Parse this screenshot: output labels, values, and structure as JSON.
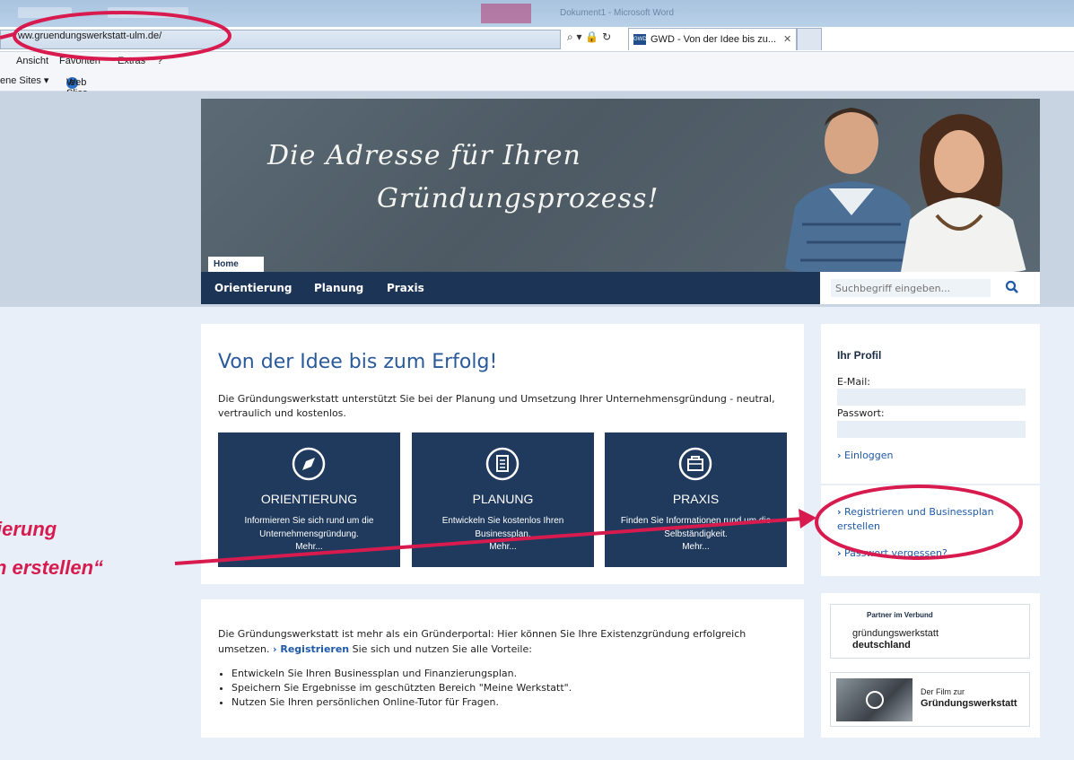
{
  "browser": {
    "url": "ww.gruendungswerkstatt-ulm.de/",
    "address_icons": "⌕ ▾ 🔒 ↻",
    "tab_favicon": "GWD",
    "tab_title": "GWD - Von der Idee bis zu...",
    "tab_close": "✕",
    "background_window_title": "Dokument1 - Microsoft Word",
    "menu": [
      "Ansicht",
      "Favoriten",
      "Extras",
      "?"
    ],
    "favorites": {
      "item1": "ene Sites ▾",
      "item2": "Web Slice-Katalog ▾"
    }
  },
  "hero": {
    "line1": "Die Adresse für Ihren",
    "line2": "Gründungsprozess!",
    "home_tab": "Home"
  },
  "nav": {
    "items": [
      "Orientierung",
      "Planung",
      "Praxis"
    ],
    "search_placeholder": "Suchbegriff eingeben..."
  },
  "main": {
    "title": "Von der Idee bis zum Erfolg!",
    "intro": "Die Gründungswerkstatt unterstützt Sie bei der Planung und Umsetzung Ihrer Unternehmensgründung - neutral, vertraulich und kostenlos.",
    "tiles": [
      {
        "title": "ORIENTIERUNG",
        "desc": "Informieren Sie sich rund um die Unternehmensgründung.",
        "more": "Mehr..."
      },
      {
        "title": "PLANUNG",
        "desc": "Entwickeln Sie kostenlos Ihren Businessplan.",
        "more": "Mehr..."
      },
      {
        "title": "PRAXIS",
        "desc": "Finden Sie Informationen rund um die Selbständigkeit.",
        "more": "Mehr..."
      }
    ]
  },
  "info": {
    "text_before": "Die Gründungswerkstatt ist mehr als ein Gründerportal: Hier können Sie Ihre Existenzgründung erfolgreich umsetzen. ",
    "register_link": "› Registrieren",
    "text_after": " Sie sich und nutzen Sie alle Vorteile:",
    "bullets": [
      "Entwickeln Sie Ihren Businessplan und Finanzierungsplan.",
      "Speichern Sie Ergebnisse im geschützten Bereich \"Meine Werkstatt\".",
      "Nutzen Sie Ihren persönlichen Online-Tutor für Fragen."
    ]
  },
  "profile": {
    "title": "Ihr Profil",
    "email_label": "E-Mail:",
    "password_label": "Passwort:",
    "login_link": "Einloggen",
    "register_link_line1": "Registrieren und Businessplan",
    "register_link_line2": "erstellen",
    "forgot_link": "Passwort vergessen?"
  },
  "partner": {
    "label": "Partner im Verbund",
    "name_line1": "gründungswerkstatt",
    "name_line2": "deutschland",
    "film_line1": "Der Film zur",
    "film_line2": "Gründungswerkstatt"
  },
  "annotation": {
    "line1": "ierung",
    "line2": "n erstellen“",
    "color": "#d81b4f"
  }
}
